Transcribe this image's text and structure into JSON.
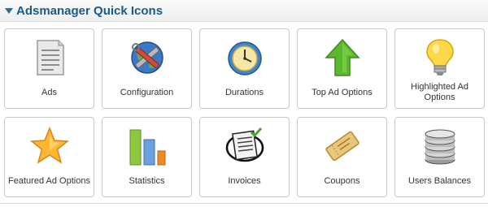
{
  "panel": {
    "title": "Adsmanager Quick Icons"
  },
  "icons": [
    {
      "label": "Ads",
      "icon": "document-icon"
    },
    {
      "label": "Configuration",
      "icon": "tools-globe-icon"
    },
    {
      "label": "Durations",
      "icon": "clock-icon"
    },
    {
      "label": "Top Ad Options",
      "icon": "up-arrow-icon"
    },
    {
      "label": "Highlighted Ad Options",
      "icon": "lightbulb-icon"
    },
    {
      "label": "Featured Ad Options",
      "icon": "star-icon"
    },
    {
      "label": "Statistics",
      "icon": "bar-chart-icon"
    },
    {
      "label": "Invoices",
      "icon": "invoice-icon"
    },
    {
      "label": "Coupons",
      "icon": "coupon-icon"
    },
    {
      "label": "Users Balances",
      "icon": "coins-icon"
    }
  ]
}
